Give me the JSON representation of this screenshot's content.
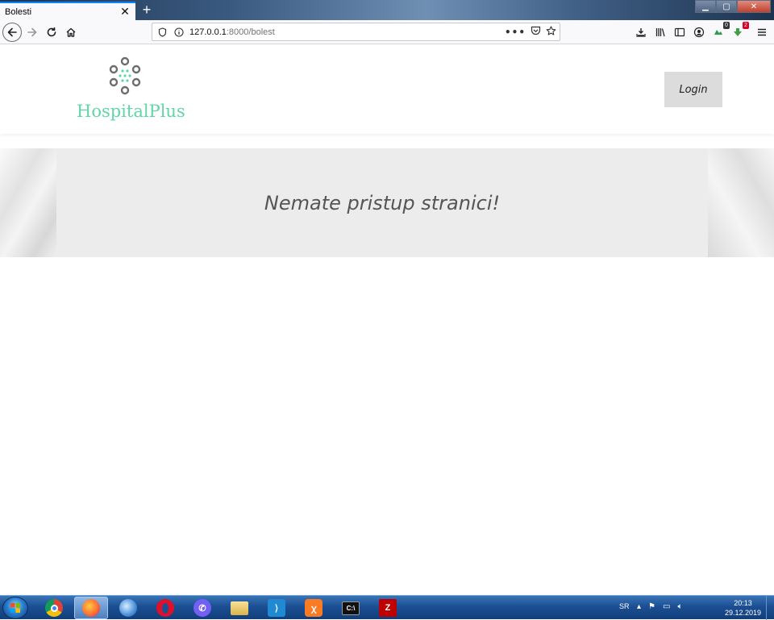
{
  "browser": {
    "tab_title": "Bolesti",
    "tab_close": "✕",
    "new_tab": "+",
    "url_host": "127.0.0.1",
    "url_rest": ":8000/bolest",
    "window_controls": {
      "minimize": "▁",
      "maximize": "▢",
      "close": "✕"
    },
    "download_badge": "0",
    "addon_badge": "2"
  },
  "site": {
    "brand": "HospitalPlus",
    "brand_color": "#5fd6a6",
    "login_label": "Login",
    "banner_message": "Nemate pristup stranici!"
  },
  "taskbar": {
    "apps": [
      {
        "name": "chrome"
      },
      {
        "name": "firefox"
      },
      {
        "name": "thunderbird"
      },
      {
        "name": "opera"
      },
      {
        "name": "viber"
      },
      {
        "name": "file-explorer"
      },
      {
        "name": "vscode"
      },
      {
        "name": "xampp"
      },
      {
        "name": "cmd"
      },
      {
        "name": "filezilla"
      }
    ],
    "language": "SR",
    "time": "20:13",
    "date": "29.12.2019"
  },
  "icons": {
    "back": "back-arrow-icon",
    "forward": "forward-arrow-icon",
    "reload": "reload-icon",
    "home": "home-icon",
    "shield": "tracking-shield-icon",
    "info": "site-info-icon",
    "page_actions": "more-actions-icon",
    "pocket": "pocket-icon",
    "bookmark": "bookmark-star-icon",
    "menu": "hamburger-menu-icon"
  }
}
